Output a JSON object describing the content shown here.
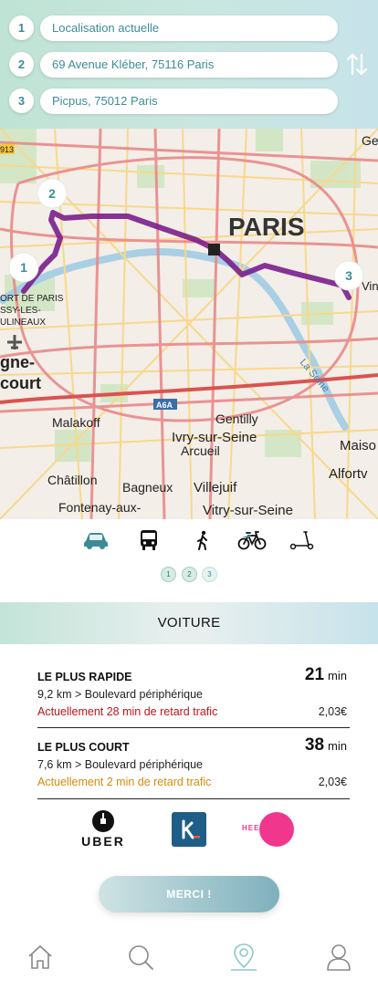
{
  "stops": [
    {
      "num": "1",
      "value": "Localisation actuelle"
    },
    {
      "num": "2",
      "value": "69 Avenue Kléber, 75116 Paris"
    },
    {
      "num": "3",
      "value": "Picpus, 75012 Paris"
    }
  ],
  "swap_icon": "swap-vertical-icon",
  "map": {
    "labels": {
      "paris": "PARIS",
      "malakoff": "Malakoff",
      "gentilly": "Gentilly",
      "ivry": "Ivry-sur-Seine",
      "arcueil": "Arcueil",
      "maiso": "Maiso",
      "alfortv": "Alfortv",
      "chatillon": "Châtillon",
      "bagneux": "Bagneux",
      "villejuif": "Villejuif",
      "fontenay": "Fontenay-aux-",
      "vitry": "Vitry-sur-Seine",
      "court": "court",
      "gne": "gne-",
      "ortdeparis": "ORT DE PARIS",
      "issy": "SSY-LES-",
      "ulineaux": "ULINEAUX",
      "seine": "La Seine",
      "a6a": "A6A",
      "r913": "913",
      "ge": "Ge",
      "vin": "Vin"
    },
    "markers": [
      "1",
      "2",
      "3"
    ],
    "route_color": "#7a1e8c"
  },
  "modes": [
    {
      "name": "car-icon",
      "active": true
    },
    {
      "name": "bus-icon",
      "active": false
    },
    {
      "name": "walk-icon",
      "active": false
    },
    {
      "name": "bike-icon",
      "active": false
    },
    {
      "name": "scooter-icon",
      "active": false
    }
  ],
  "pages": [
    "1",
    "2",
    "3"
  ],
  "section": {
    "title": "VOITURE"
  },
  "options": [
    {
      "title": "LE PLUS RAPIDE",
      "route": "9,2 km > Boulevard périphérique",
      "delay": "Actuellement 28 min de retard trafic",
      "delay_color": "#c0121d",
      "time": "21",
      "unit": "min",
      "price": "2,03€"
    },
    {
      "title": "LE PLUS COURT",
      "route": "7,6 km > Boulevard périphérique",
      "delay": "Actuellement 2 min de retard trafic",
      "delay_color": "#d98a0a",
      "time": "38",
      "unit": "min",
      "price": "2,03€"
    }
  ],
  "partners": {
    "uber": "UBER",
    "kapten": "k",
    "heetch": "HEETCH"
  },
  "merci_label": "MERCI !",
  "tabs": [
    {
      "name": "home-icon"
    },
    {
      "name": "search-icon"
    },
    {
      "name": "location-pin-icon",
      "active": true
    },
    {
      "name": "profile-icon"
    }
  ],
  "colors": {
    "accent": "#3c8c97",
    "active_tab": "#8ec7c9"
  }
}
